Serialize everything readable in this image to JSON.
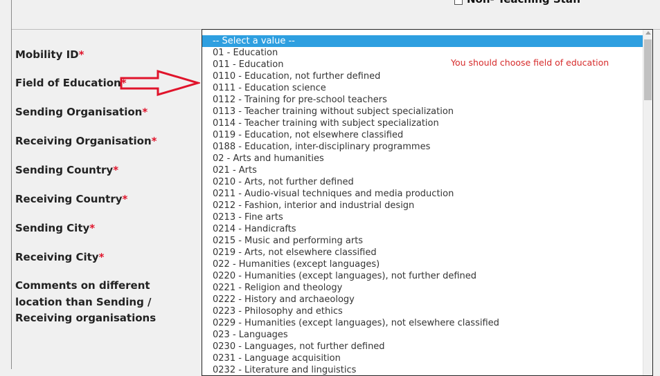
{
  "header": {
    "checkbox_label": "Non- Teaching Staff"
  },
  "form": {
    "labels": [
      {
        "text": "Mobility ID",
        "required": "*"
      },
      {
        "text": "Field of Education",
        "required": "*"
      },
      {
        "text": "Sending Organisation",
        "required": "*"
      },
      {
        "text": "Receiving Organisation",
        "required": "*"
      },
      {
        "text": "Sending Country",
        "required": "*"
      },
      {
        "text": "Receiving Country",
        "required": "*"
      },
      {
        "text": "Sending City",
        "required": "*"
      },
      {
        "text": "Receiving City",
        "required": "*"
      }
    ],
    "comments_label": "Comments on different location than Sending / Receiving organisations"
  },
  "annotation": {
    "arrow": "red-outline-arrow-right",
    "color": "#e0142b"
  },
  "dropdown": {
    "selected_index": 0,
    "selected_color": "#2e9fe0",
    "error_message": "You should choose field of education",
    "options": [
      "-- Select a value --",
      "01 - Education",
      "011 - Education",
      "0110 - Education, not further defined",
      "0111 - Education science",
      "0112 - Training for pre-school teachers",
      "0113 - Teacher training without subject specialization",
      "0114 - Teacher training with subject specialization",
      "0119 - Education, not elsewhere classified",
      "0188 - Education, inter-disciplinary programmes",
      "02 - Arts and humanities",
      "021 - Arts",
      "0210 - Arts, not further defined",
      "0211 - Audio-visual techniques and media production",
      "0212 - Fashion, interior and industrial design",
      "0213 - Fine arts",
      "0214 - Handicrafts",
      "0215 - Music and performing arts",
      "0219 - Arts, not elsewhere classified",
      "022 - Humanities (except languages)",
      "0220 - Humanities (except languages), not further defined",
      "0221 - Religion and theology",
      "0222 - History and archaeology",
      "0223 - Philosophy and ethics",
      "0229 - Humanities (except languages), not elsewhere classified",
      "023 - Languages",
      "0230 - Languages, not further defined",
      "0231 - Language acquisition",
      "0232 - Literature and linguistics"
    ]
  }
}
